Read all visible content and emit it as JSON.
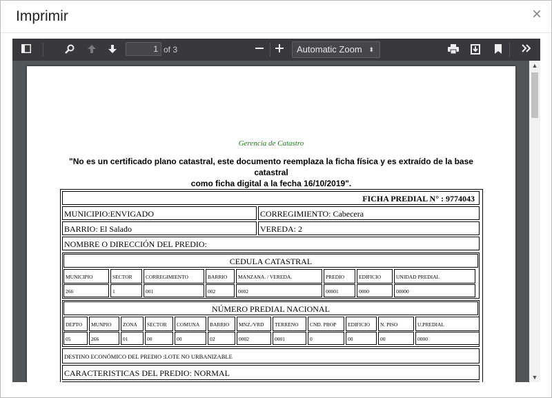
{
  "dialog": {
    "title": "Imprimir",
    "close_glyph": "×"
  },
  "toolbar": {
    "page_number": "1",
    "page_count_text": "of 3",
    "zoom_label": "Automatic Zoom",
    "zoom_arrow": "▲▼"
  },
  "icons": [
    "sidebar-toggle-icon",
    "search-icon",
    "page-up-icon",
    "page-down-icon",
    "zoom-out-icon",
    "zoom-in-icon",
    "print-icon",
    "download-icon",
    "bookmark-icon",
    "tools-icon",
    "scroll-up-icon",
    "scroll-down-icon"
  ],
  "document": {
    "gerencia": "Gerencia de Catastro",
    "notice_line1": "\"No es un certificado plano catastral, este documento reemplaza la ficha física y es extraído de la base catastral",
    "notice_line2": "como ficha digital a la fecha 16/10/2019\".",
    "ficha": "FICHA PREDIAL N° :  9774043",
    "municipio": "MUNICIPIO:ENVIGADO",
    "corregimiento": "CORREGIMIENTO: Cabecera",
    "barrio": "BARRIO: El Salado",
    "vereda": "VEREDA: 2",
    "nombre": "NOMBRE O DIRECCIÓN DEL PREDIO:",
    "cedula_title": "CEDULA CATASTRAL",
    "cedula_headers": [
      "MUNICIPIO",
      "SECTOR",
      "CORREGIMIENTO",
      "BARRIO",
      "MANZANA. / VEREDA.",
      "PREDIO",
      "EDIFICIO",
      "UNIDAD PREDIAL"
    ],
    "cedula_values": [
      "266",
      "1",
      "001",
      "002",
      "0002",
      "00001",
      "0000",
      "00000"
    ],
    "numero_title": "NÚMERO PREDIAL NACIONAL",
    "numero_headers": [
      "DEPTO",
      "MUNPIO",
      "ZONA",
      "SECTOR",
      "COMUNA",
      "BARRIO",
      "MNZ./VRD",
      "TERRENO",
      "CND. PROP",
      "EDIFICIO",
      "N. PISO",
      "U.PREDIAL"
    ],
    "numero_values": [
      "05",
      "266",
      "01",
      "00",
      "00",
      "02",
      "0002",
      "0001",
      "0",
      "00",
      "00",
      "0000"
    ],
    "destino": "DESTINO ECONÓMICO DEL PREDIO :LOTE NO URBANIZABLE",
    "caracteristicas": "CARACTERISTICAS DEL PREDIO: NORMAL"
  }
}
